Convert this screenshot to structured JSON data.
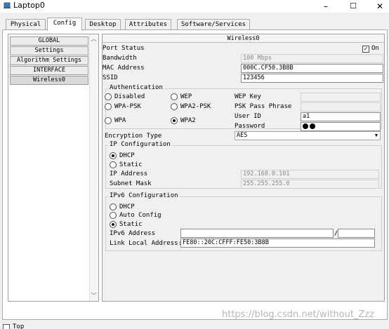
{
  "window": {
    "title": "Laptop0",
    "minimize": "–",
    "maximize": "☐",
    "close": "✕"
  },
  "tabs": [
    "Physical",
    "Config",
    "Desktop",
    "Attributes",
    "Software/Services"
  ],
  "active_tab": "Config",
  "nav": [
    "GLOBAL",
    "Settings",
    "Algorithm Settings",
    "INTERFACE",
    "Wireless0"
  ],
  "selected_nav": "Wireless0",
  "panel": {
    "header": "Wireless0",
    "port_status": {
      "label": "Port Status",
      "checked": true,
      "value": "On"
    },
    "bandwidth": {
      "label": "Bandwidth",
      "value": "100 Mbps"
    },
    "mac": {
      "label": "MAC Address",
      "value": "000C.CF50.3B8B"
    },
    "ssid": {
      "label": "SSID",
      "value": "123456"
    },
    "authentication": {
      "title": "Authentication",
      "options": [
        "Disabled",
        "WEP",
        "WPA-PSK",
        "WPA2-PSK",
        "WPA",
        "WPA2"
      ],
      "selected": "WPA2",
      "wep_key_label": "WEP Key",
      "psk_label": "PSK Pass Phrase",
      "user_id_label": "User ID",
      "user_id_value": "a1",
      "password_label": "Password"
    },
    "encryption": {
      "label": "Encryption Type",
      "value": "AES"
    },
    "ip_config": {
      "title": "IP Configuration",
      "dhcp": "DHCP",
      "static": "Static",
      "selected": "DHCP",
      "ip_label": "IP Address",
      "ip_value": "192.168.0.101",
      "mask_label": "Subnet Mask",
      "mask_value": "255.255.255.0"
    },
    "ipv6_config": {
      "title": "IPv6 Configuration",
      "dhcp": "DHCP",
      "auto": "Auto Config",
      "static": "Static",
      "selected": "Static",
      "addr_label": "IPv6 Address",
      "slash": "/",
      "link_local_label": "Link Local Address:",
      "link_local_value": "FE80::20C:CFFF:FE50:3B8B"
    }
  },
  "bottom": {
    "checkbox_label": "Top"
  },
  "watermark": "https://blog.csdn.net/without_Zzz"
}
